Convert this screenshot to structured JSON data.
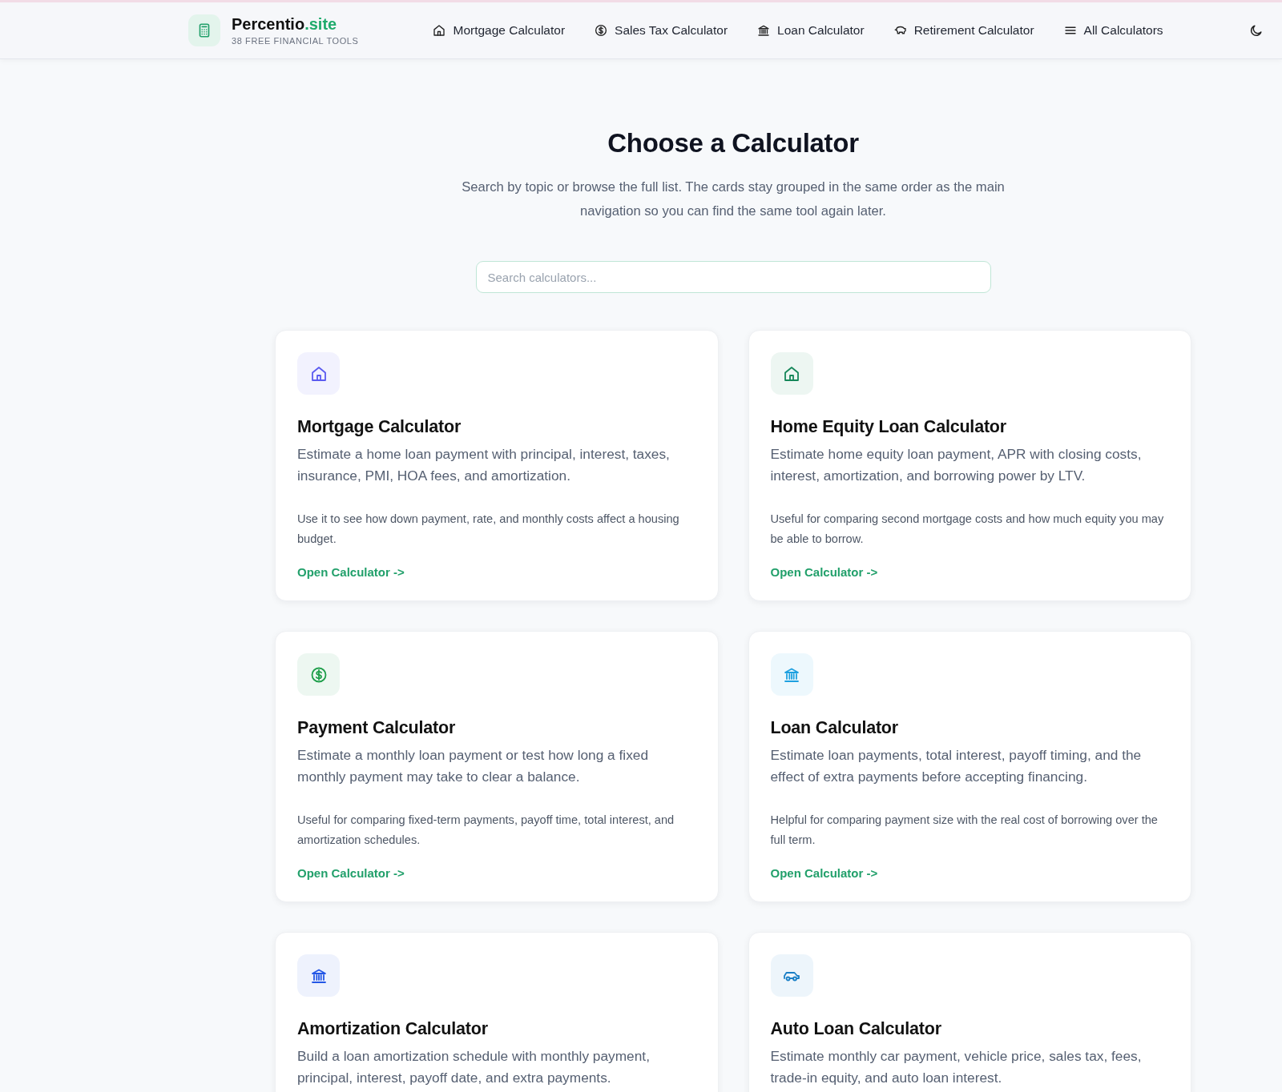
{
  "header": {
    "brand": "Percentio",
    "brand_suffix": ".site",
    "tagline": "38 FREE FINANCIAL TOOLS",
    "nav": [
      {
        "label": "Mortgage Calculator",
        "kind": "house"
      },
      {
        "label": "Sales Tax Calculator",
        "kind": "dollar"
      },
      {
        "label": "Loan Calculator",
        "kind": "bank"
      },
      {
        "label": "Retirement Calculator",
        "kind": "piggy"
      },
      {
        "label": "All Calculators",
        "kind": "menu"
      }
    ]
  },
  "heading": "Choose a Calculator",
  "intro": "Search by topic or browse the full list. The cards stay grouped in the same order as the main navigation so you can find the same tool again later.",
  "search": {
    "placeholder": "Search calculators..."
  },
  "cards": [
    {
      "kind": "house",
      "color": "#5b5bf0",
      "title": "Mortgage Calculator",
      "description": "Estimate a home loan payment with principal, interest, taxes, insurance, PMI, HOA fees, and amortization.",
      "note": "Use it to see how down payment, rate, and monthly costs affect a housing budget.",
      "link": "Open Calculator ->"
    },
    {
      "kind": "house",
      "color": "#16875a",
      "title": "Home Equity Loan Calculator",
      "description": "Estimate home equity loan payment, APR with closing costs, interest, amortization, and borrowing power by LTV.",
      "note": "Useful for comparing second mortgage costs and how much equity you may be able to borrow.",
      "link": "Open Calculator ->"
    },
    {
      "kind": "dollar",
      "color": "#1e9e4a",
      "title": "Payment Calculator",
      "description": "Estimate a monthly loan payment or test how long a fixed monthly payment may take to clear a balance.",
      "note": "Useful for comparing fixed-term payments, payoff time, total interest, and amortization schedules.",
      "link": "Open Calculator ->"
    },
    {
      "kind": "bank",
      "color": "#1ea0e0",
      "title": "Loan Calculator",
      "description": "Estimate loan payments, total interest, payoff timing, and the effect of extra payments before accepting financing.",
      "note": "Helpful for comparing payment size with the real cost of borrowing over the full term.",
      "link": "Open Calculator ->"
    },
    {
      "kind": "bank",
      "color": "#2457e6",
      "title": "Amortization Calculator",
      "description": "Build a loan amortization schedule with monthly payment, principal, interest, payoff date, and extra payments."
    },
    {
      "kind": "car",
      "color": "#1a7fc6",
      "title": "Auto Loan Calculator",
      "description": "Estimate monthly car payment, vehicle price, sales tax, fees, trade-in equity, and auto loan interest."
    }
  ]
}
